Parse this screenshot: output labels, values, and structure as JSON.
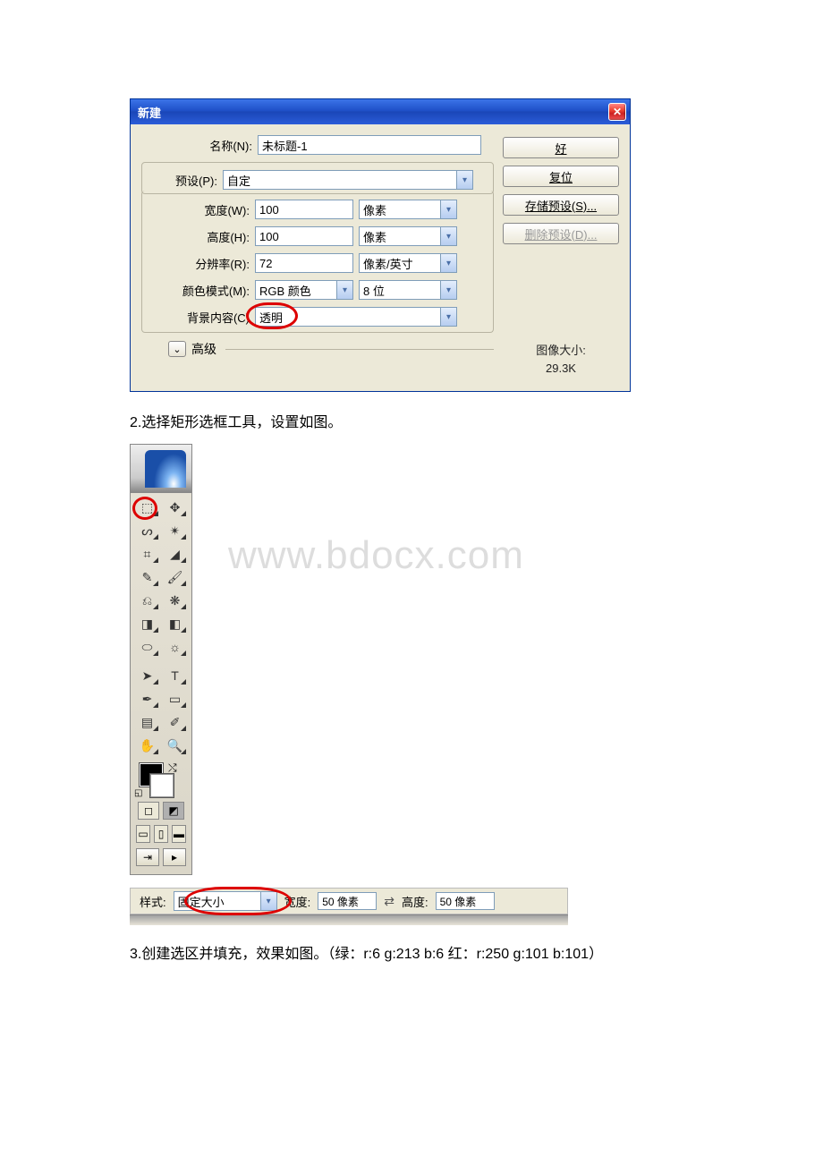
{
  "dialog": {
    "title": "新建",
    "name_label": "名称(N):",
    "name_value": "未标题-1",
    "preset_label": "预设(P):",
    "preset_value": "自定",
    "width_label": "宽度(W):",
    "width_value": "100",
    "width_unit": "像素",
    "height_label": "高度(H):",
    "height_value": "100",
    "height_unit": "像素",
    "res_label": "分辨率(R):",
    "res_value": "72",
    "res_unit": "像素/英寸",
    "mode_label": "颜色模式(M):",
    "mode_value": "RGB 颜色",
    "depth_value": "8 位",
    "bg_label": "背景内容(C)",
    "bg_value": "透明",
    "advanced_label": "高级",
    "btn_ok": "好",
    "btn_reset": "复位",
    "btn_save_preset": "存储预设(S)...",
    "btn_delete_preset": "删除预设(D)...",
    "size_label": "图像大小:",
    "size_value": "29.3K"
  },
  "caption_2": "2.选择矩形选框工具，设置如图。",
  "watermark": "www.bdocx.com",
  "toolbox": {
    "tools": [
      {
        "name": "marquee",
        "glyph": "⬚"
      },
      {
        "name": "move",
        "glyph": "✥"
      },
      {
        "name": "lasso",
        "glyph": "ᔕ"
      },
      {
        "name": "wand",
        "glyph": "✴"
      },
      {
        "name": "crop",
        "glyph": "⌗"
      },
      {
        "name": "slice",
        "glyph": "◢"
      },
      {
        "name": "healing",
        "glyph": "✎"
      },
      {
        "name": "brush",
        "glyph": "🖌"
      },
      {
        "name": "stamp",
        "glyph": "⎌"
      },
      {
        "name": "history-brush",
        "glyph": "❋"
      },
      {
        "name": "eraser",
        "glyph": "◨"
      },
      {
        "name": "gradient",
        "glyph": "◧"
      },
      {
        "name": "blur",
        "glyph": "⬭"
      },
      {
        "name": "dodge",
        "glyph": "☼"
      },
      {
        "name": "path-select",
        "glyph": "➤"
      },
      {
        "name": "type",
        "glyph": "T"
      },
      {
        "name": "pen",
        "glyph": "✒"
      },
      {
        "name": "shape",
        "glyph": "▭"
      },
      {
        "name": "notes",
        "glyph": "▤"
      },
      {
        "name": "eyedropper",
        "glyph": "✐"
      },
      {
        "name": "hand",
        "glyph": "✋"
      },
      {
        "name": "zoom",
        "glyph": "🔍"
      }
    ]
  },
  "options_bar": {
    "style_label": "样式:",
    "style_value": "固定大小",
    "width_label": "宽度:",
    "width_value": "50 像素",
    "height_label": "高度:",
    "height_value": "50 像素"
  },
  "caption_3": "3.创建选区并填充，效果如图。（绿：r:6 g:213 b:6 红：r:250 g:101 b:101）"
}
